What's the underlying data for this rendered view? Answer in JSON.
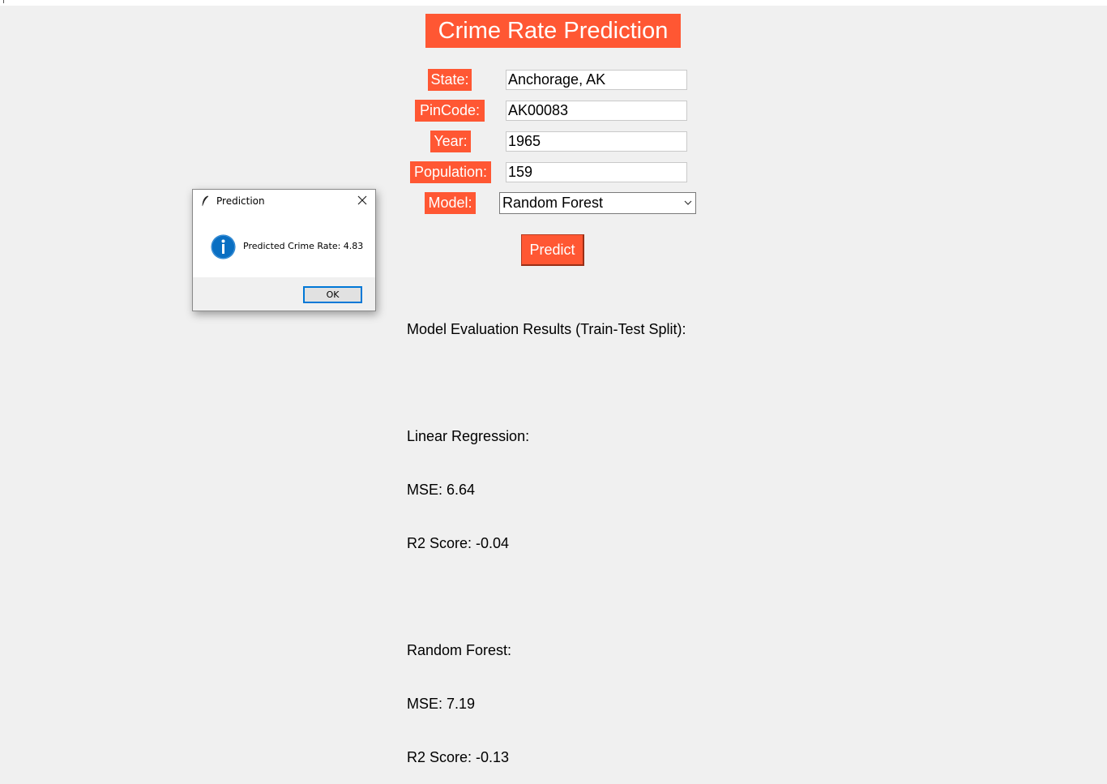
{
  "app": {
    "title": "Crime Rate Prediction"
  },
  "form": {
    "state_label": "State:",
    "state_value": "Anchorage, AK",
    "pincode_label": "PinCode:",
    "pincode_value": "AK00083",
    "year_label": "Year:",
    "year_value": "1965",
    "population_label": "Population:",
    "population_value": "159",
    "model_label": "Model:",
    "model_selected": "Random Forest",
    "predict_label": "Predict"
  },
  "results": {
    "heading": "Model Evaluation Results (Train-Test Split):",
    "linear": {
      "name": "Linear Regression:",
      "mse": "MSE: 6.64",
      "r2": "R2 Score: -0.04"
    },
    "forest": {
      "name": "Random Forest:",
      "mse": "MSE: 7.19",
      "r2": "R2 Score: -0.13"
    }
  },
  "dialog": {
    "title": "Prediction",
    "message": "Predicted Crime Rate: 4.83",
    "ok_label": "OK",
    "icon": "info-icon"
  },
  "colors": {
    "accent": "#ff5733",
    "background": "#f0f0f0",
    "info_blue": "#0a6fc2",
    "focus_blue": "#0078d7"
  }
}
